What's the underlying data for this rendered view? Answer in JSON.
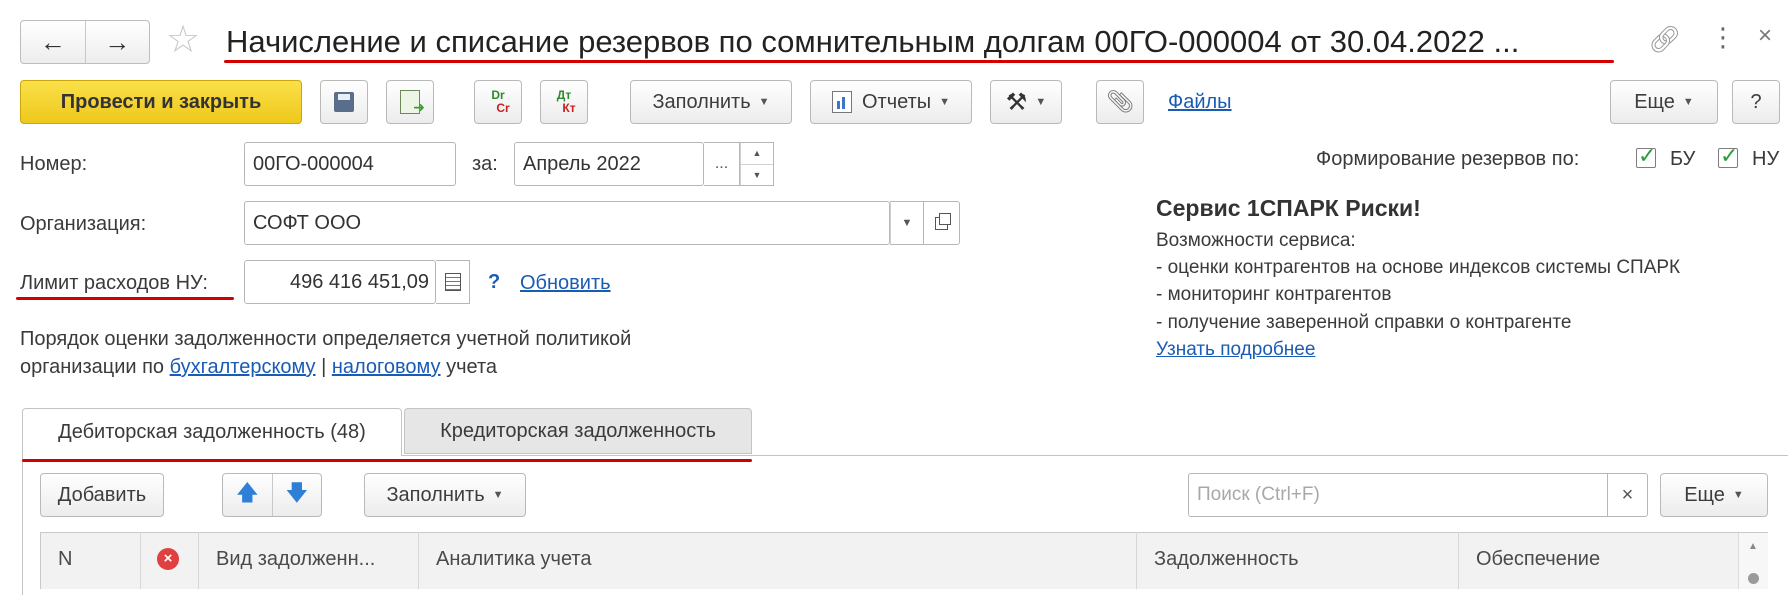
{
  "titlebar": {
    "title": "Начисление и списание резервов по сомнительным долгам 00ГО-000004 от 30.04.2022 ..."
  },
  "toolbar": {
    "post_and_close": "Провести и закрыть",
    "dr_cr_top": "Dr",
    "dr_cr_bottom": "Cr",
    "dt_kt_top": "Дт",
    "dt_kt_bottom": "Кт",
    "fill": "Заполнить",
    "reports": "Отчеты",
    "files": "Файлы",
    "more": "Еще",
    "help": "?"
  },
  "form": {
    "number_label": "Номер:",
    "number_value": "00ГО-000004",
    "for_label": "за:",
    "period_value": "Апрель 2022",
    "ellipsis": "...",
    "org_label": "Организация:",
    "org_value": "СОФТ ООО",
    "limit_label": "Лимит расходов НУ:",
    "limit_value": "496 416 451,09",
    "question": "?",
    "update_link": "Обновить",
    "policy_text_1": "Порядок оценки задолженности определяется учетной политикой",
    "policy_text_2_prefix": "организации по",
    "policy_link_accounting": "бухгалтерскому",
    "policy_sep": "|",
    "policy_link_tax": "налоговому",
    "policy_suffix": "учета",
    "reserves_label": "Формирование резервов по:",
    "bu_label": "БУ",
    "nu_label": "НУ"
  },
  "spark": {
    "title": "Сервис 1СПАРК Риски!",
    "subtitle": "Возможности сервиса:",
    "items": [
      "- оценки контрагентов на основе индексов системы СПАРК",
      "- мониторинг контрагентов",
      "- получение заверенной справки о контрагенте"
    ],
    "more_link": "Узнать подробнее"
  },
  "tabs": [
    {
      "label": "Дебиторская задолженность (48)",
      "active": true
    },
    {
      "label": "Кредиторская задолженность",
      "active": false
    }
  ],
  "table_toolbar": {
    "add": "Добавить",
    "fill": "Заполнить",
    "search_placeholder": "Поиск (Ctrl+F)",
    "clear": "×",
    "more": "Еще"
  },
  "table": {
    "columns": [
      "N",
      "Вид задолженн...",
      "Аналитика учета",
      "Задолженность",
      "Обеспечение"
    ]
  },
  "colors": {
    "primary_button": "#f5d32a",
    "link": "#1a5bb5",
    "annotation_red": "#d40000",
    "check_green": "#2e9b3a"
  }
}
